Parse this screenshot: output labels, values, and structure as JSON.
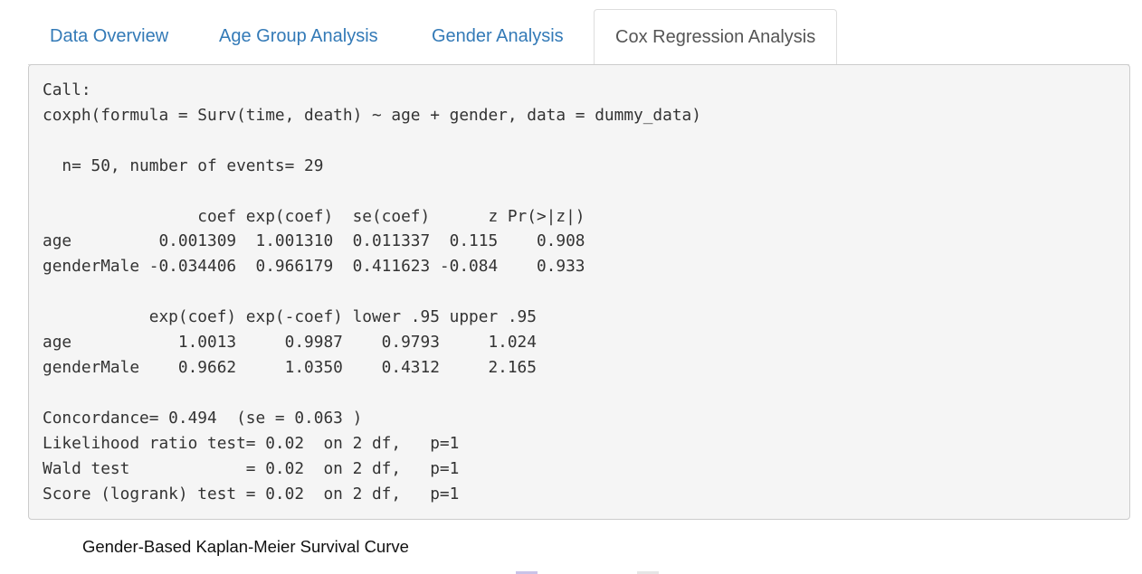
{
  "tabs": [
    {
      "label": "Data Overview",
      "active": false
    },
    {
      "label": "Age Group Analysis",
      "active": false
    },
    {
      "label": "Gender Analysis",
      "active": false
    },
    {
      "label": "Cox Regression Analysis",
      "active": true
    }
  ],
  "cox_output": "Call:\ncoxph(formula = Surv(time, death) ~ age + gender, data = dummy_data)\n\n  n= 50, number of events= 29 \n\n                coef exp(coef)  se(coef)      z Pr(>|z|)\nage         0.001309  1.001310  0.011337  0.115    0.908\ngenderMale -0.034406  0.966179  0.411623 -0.084    0.933\n\n           exp(coef) exp(-coef) lower .95 upper .95\nage           1.0013     0.9987    0.9793     1.024\ngenderMale    0.9662     1.0350    0.4312     2.165\n\nConcordance= 0.494  (se = 0.063 )\nLikelihood ratio test= 0.02  on 2 df,   p=1\nWald test            = 0.02  on 2 df,   p=1\nScore (logrank) test = 0.02  on 2 df,   p=1",
  "plot": {
    "title": "Gender-Based Kaplan-Meier Survival Curve"
  },
  "colors": {
    "link": "#337ab7",
    "active_tab_text": "#555555",
    "output_bg": "#f5f5f5",
    "legend_swatch_1": "#c9c3e8",
    "legend_swatch_2": "#e6e6e6"
  }
}
